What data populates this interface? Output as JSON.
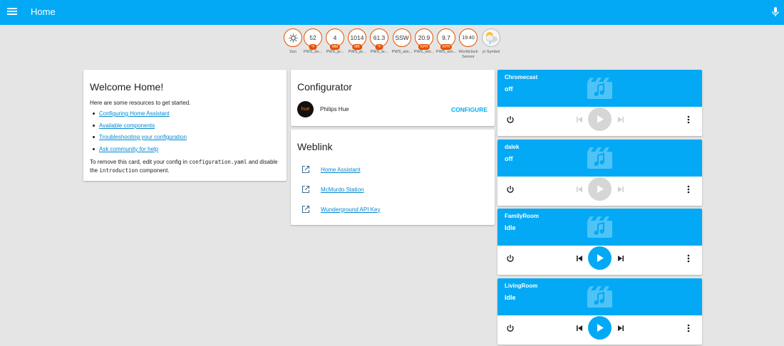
{
  "header": {
    "title": "Home",
    "menu_icon": "menu-icon",
    "mic_icon": "microphone-icon"
  },
  "badges": [
    {
      "value": "",
      "icon": "sun-icon",
      "unit": "",
      "label": "Sun"
    },
    {
      "value": "52",
      "unit": "°F",
      "label": "PWS_de..."
    },
    {
      "value": "4",
      "unit": "MM",
      "label": "PWS_pr..."
    },
    {
      "value": "1014",
      "unit": "MB",
      "label": "PWS_pr..."
    },
    {
      "value": "61.3",
      "unit": "°F",
      "label": "PWS_te..."
    },
    {
      "value": "SSW",
      "unit": "",
      "label": "PWS_win..."
    },
    {
      "value": "20.9",
      "unit": "KPH",
      "label": "PWS_win..."
    },
    {
      "value": "9.7",
      "unit": "KPH",
      "label": "PWS_win..."
    },
    {
      "value": "19:40",
      "unit": "",
      "label": "Worldclock",
      "label2": "Sensor"
    },
    {
      "value": "",
      "icon": "weather-cloud-icon",
      "unit": "",
      "label": "yr Symbol"
    }
  ],
  "welcome": {
    "title": "Welcome Home!",
    "intro": "Here are some resources to get started.",
    "links": [
      "Configuring Home Assistant",
      "Available components",
      "Troubleshooting your configuration",
      "Ask community for help"
    ],
    "outro_1": "To remove this card, edit your config in ",
    "outro_code_1": "configuration.yaml",
    "outro_2": " and disable the ",
    "outro_code_2": "introduction",
    "outro_3": " component."
  },
  "configurator": {
    "title": "Configurator",
    "item_logo": "hue",
    "item_name": "Philips Hue",
    "action": "CONFIGURE"
  },
  "weblink": {
    "title": "Weblink",
    "links": [
      "Home Assistant",
      "McMurdo Station",
      "Wunderground API Key"
    ]
  },
  "players": [
    {
      "name": "Chromecast",
      "state": "off",
      "active": false
    },
    {
      "name": "dalek",
      "state": "off",
      "active": false
    },
    {
      "name": "FamilyRoom",
      "state": "Idle",
      "active": true
    },
    {
      "name": "LivingRoom",
      "state": "Idle",
      "active": true
    }
  ],
  "colors": {
    "accent": "#03a9f4",
    "badge_border": "#e65100",
    "background": "#e5e5e5",
    "link": "#0288d1",
    "disabled": "#bdbdbd"
  }
}
